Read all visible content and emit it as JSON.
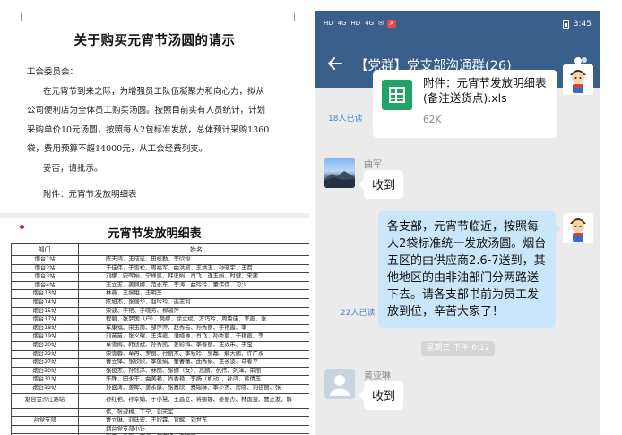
{
  "document": {
    "title": "关于购买元宵节汤圆的请示",
    "body_lines": [
      "工会委员会：",
      "在元宵节到来之际，为增强员工队伍凝聚力和向心力，拟从",
      "公司便利店为全体员工购买汤圆。按照目前实有人员统计，计划",
      "采购单价10元汤圆，按照每人2包标准发放，总体预计采购1360",
      "袋，费用预算不超14000元，从工会经费列支。",
      "妥否，请批示。",
      "附件：元宵节发放明细表"
    ],
    "table_title": "元宵节发放明细表",
    "table_headers": [
      "部门",
      "姓名"
    ],
    "table_rows": [
      [
        "烟台1站",
        "陈天鸿、王成征、田校勤、李欣怡"
      ],
      [
        "烟台2站",
        "于佳伟、于雪松、周福军、曲洪波、王洪玉、孙晓宇、王箭"
      ],
      [
        "烟台3站",
        "刘娜、安晖娟、宁峰凯、韩忠娟、肖飞、逢玉娟、时健、宋建"
      ],
      [
        "烟台4站",
        "王立志、姜佩娜、范永东、李涛、曲玲玲、董伟伟、刁少"
      ],
      [
        "烟台13站",
        "林燕、王婉娥、王明芝"
      ],
      [
        "烟台14站",
        "陈旭杰、张居华、赵玲玲、连志利"
      ],
      [
        "烟台15站",
        "宋波、于艳、于晓芳、柳淑萍"
      ],
      [
        "烟台17站",
        "程丽、张梦国（户）、吴娜、徐立斌、方巧玲、周鲁佳、李霞、张"
      ],
      [
        "烟台18站",
        "车康福、宋玉周、邹萍萍、赵秀云、孙秀丽、于艳霞、李"
      ],
      [
        "烟台19站",
        "刘苗苗、张义曜、王海霞、潘娅琳、肖飞、孙秀丽、于艳霞、李"
      ],
      [
        "烟台20站",
        "牟雪梅、韩侦斌、孙秀凯、姜彩梅、李春丽、王焱禾、于宝"
      ],
      [
        "烟台22站",
        "宋雪蓉、牟丹、罗丽、付丽杰、李秋玲、吴磊、解大鹏、许广永"
      ],
      [
        "烟台27站",
        "曹立锋、张欣欣、李莲娟、董曹蕾、曲秀娟、王长凌、马春平"
      ],
      [
        "烟台30站",
        "张俊杰、孙铭泽、林丽、张娜（女）、高鹏、仇伟、刘洋、宋丽"
      ],
      [
        "烟台31站",
        "朱殊、田永丰、曲美艳、尚香艳、李扬（机动）、孙鸿、蒋倩玉"
      ],
      [
        "烟台32站",
        "孙盛涛、姜晖、姜永康、张嘉欣、费瑞琳、李少杰、房晓、刘佳丽、张"
      ],
      [
        "烟台金沙江路站",
        "孙红艳、孙幸娟、于小慧、王昌立、蒋娜娜、姜丽杰、林国益、曹正发、解"
      ],
      [
        "",
        "伟、张淑棉、丁宁、刘志军"
      ],
      [
        "台党支部",
        "曹立琳、刘廷宏、王欣霖、宣解、刘世东"
      ],
      [
        "",
        "烟台党支部小计"
      ],
      [
        "",
        "张宁、肖飞、李涛、董开红、曹丽丽"
      ]
    ]
  },
  "phone": {
    "status_left": [
      "HD",
      "4G",
      "HD",
      "4G",
      "✉",
      "A"
    ],
    "status_time": "3:45",
    "nav_title": "【党群】党支部沟通群(26)",
    "messages": {
      "file": {
        "name": "附件：元宵节发放明细表(备注送货点).xls",
        "size": "62K",
        "read": "18人已读"
      },
      "reply1": {
        "sender": "曲军",
        "text": "收到"
      },
      "announcement": {
        "text": "各支部，元宵节临近，按照每人2袋标准统一发放汤圆。烟台五区的由供应商2.6-7送到，其他地区的由非油部门分两路送下去。请各支部书前为员工发放到位，辛苦大家了！",
        "read": "22人已读"
      },
      "timestamp": "星期三 下午 6:12",
      "reply2": {
        "sender": "黄亚琳",
        "text": "收到"
      }
    }
  }
}
